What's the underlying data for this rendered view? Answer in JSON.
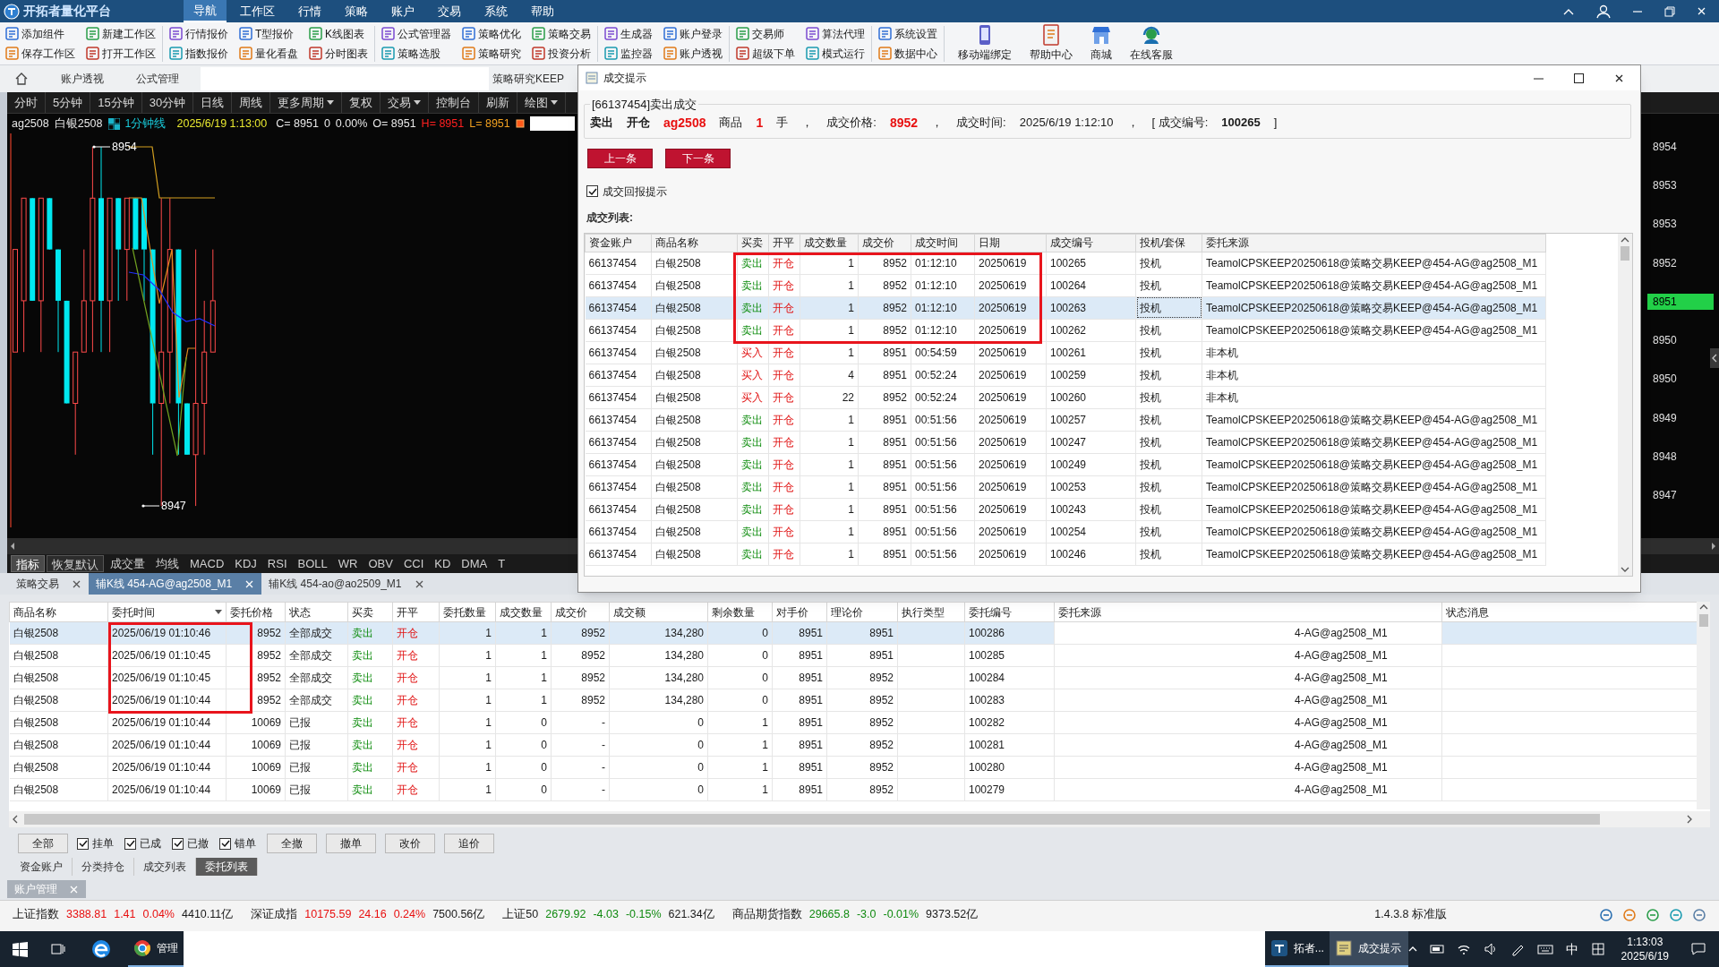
{
  "app": {
    "title": "开拓者量化平台"
  },
  "menu": [
    {
      "label": "导航",
      "selected": true
    },
    {
      "label": "工作区",
      "selected": false
    },
    {
      "label": "行情",
      "selected": false
    },
    {
      "label": "策略",
      "selected": false
    },
    {
      "label": "账户",
      "selected": false
    },
    {
      "label": "交易",
      "selected": false
    },
    {
      "label": "系统",
      "selected": false
    },
    {
      "label": "帮助",
      "selected": false
    }
  ],
  "toolbar": {
    "groups": [
      [
        [
          "添加组件",
          "保存工作区"
        ],
        [
          "新建工作区",
          "打开工作区"
        ]
      ],
      [
        [
          "行情报价",
          "指数报价"
        ],
        [
          "T型报价",
          "量化看盘"
        ],
        [
          "K线图表",
          "分时图表"
        ]
      ],
      [
        [
          "公式管理器",
          "策略选股"
        ],
        [
          "策略优化",
          "策略研究"
        ],
        [
          "策略交易",
          "投资分析"
        ]
      ],
      [
        [
          "生成器",
          "监控器"
        ],
        [
          "账户登录",
          "账户透视"
        ]
      ],
      [
        [
          "交易师",
          "超级下单"
        ],
        [
          "算法代理",
          "模式运行"
        ]
      ],
      [
        [
          "系统设置",
          "数据中心"
        ]
      ]
    ],
    "big_buttons": [
      "移动端绑定",
      "帮助中心",
      "商城",
      "在线客服"
    ]
  },
  "workspace_tabs": [
    "账户透视",
    "公式管理"
  ],
  "workspace_tabs_right": [
    "策略研究KEEP"
  ],
  "chart": {
    "periods": [
      {
        "label": "分时",
        "dropdown": false
      },
      {
        "label": "5分钟",
        "dropdown": false
      },
      {
        "label": "15分钟",
        "dropdown": false
      },
      {
        "label": "30分钟",
        "dropdown": false
      },
      {
        "label": "日线",
        "dropdown": false
      },
      {
        "label": "周线",
        "dropdown": false
      },
      {
        "label": "更多周期",
        "dropdown": true
      },
      {
        "label": "复权",
        "dropdown": false
      },
      {
        "label": "交易",
        "dropdown": true
      },
      {
        "label": "控制台",
        "dropdown": false
      },
      {
        "label": "刷新",
        "dropdown": false
      },
      {
        "label": "绘图",
        "dropdown": true
      }
    ],
    "quote": {
      "symbol": "ag2508",
      "name": "白银2508",
      "period": "1分钟线",
      "time": "2025/6/19 1:13:00",
      "close": "C= 8951",
      "change": "0",
      "pct": "0.00%",
      "open": "O= 8951",
      "high": "H= 8951",
      "low": "L= 8951"
    },
    "high_mark": "8954",
    "low_mark": "8947",
    "price_axis": [
      {
        "label": "8954",
        "selected": false
      },
      {
        "label": "8953",
        "selected": false
      },
      {
        "label": "8953",
        "selected": false
      },
      {
        "label": "8952",
        "selected": false
      },
      {
        "label": "8951",
        "selected": true
      },
      {
        "label": "8950",
        "selected": false
      },
      {
        "label": "8950",
        "selected": false
      },
      {
        "label": "8949",
        "selected": false
      },
      {
        "label": "8948",
        "selected": false
      },
      {
        "label": "8947",
        "selected": false
      }
    ],
    "indicators": [
      {
        "label": "指标",
        "kind": "button",
        "selected": true
      },
      {
        "label": "恢复默认",
        "kind": "button",
        "selected": false
      },
      {
        "label": "成交量",
        "kind": "tab",
        "selected": false
      },
      {
        "label": "均线",
        "kind": "tab",
        "selected": false
      },
      {
        "label": "MACD",
        "kind": "tab",
        "selected": false
      },
      {
        "label": "KDJ",
        "kind": "tab",
        "selected": false
      },
      {
        "label": "RSI",
        "kind": "tab",
        "selected": false
      },
      {
        "label": "BOLL",
        "kind": "tab",
        "selected": false
      },
      {
        "label": "WR",
        "kind": "tab",
        "selected": false
      },
      {
        "label": "OBV",
        "kind": "tab",
        "selected": false
      },
      {
        "label": "CCI",
        "kind": "tab",
        "selected": false
      },
      {
        "label": "KD",
        "kind": "tab",
        "selected": false
      },
      {
        "label": "DMA",
        "kind": "tab",
        "selected": false
      },
      {
        "label": "T",
        "kind": "tab",
        "selected": false
      }
    ]
  },
  "dialog": {
    "title": "成交提示",
    "group_title": "[66137454]卖出成交",
    "summary": [
      {
        "text": "卖出",
        "kind": "strong"
      },
      {
        "text": "开仓",
        "kind": "strong"
      },
      {
        "text": "ag2508",
        "kind": "accent"
      },
      {
        "text": "商品",
        "kind": "plain"
      },
      {
        "text": "1",
        "kind": "accent"
      },
      {
        "text": "手",
        "kind": "plain"
      },
      {
        "text": "，",
        "kind": "plain"
      },
      {
        "text": "成交价格:",
        "kind": "plain"
      },
      {
        "text": "8952",
        "kind": "accent"
      },
      {
        "text": "，",
        "kind": "plain"
      },
      {
        "text": "成交时间:",
        "kind": "plain"
      },
      {
        "text": "2025/6/19 1:12:10",
        "kind": "plain"
      },
      {
        "text": "，",
        "kind": "plain"
      },
      {
        "text": "[ 成交编号:",
        "kind": "plain"
      },
      {
        "text": "100265",
        "kind": "strong"
      },
      {
        "text": "]",
        "kind": "plain"
      }
    ],
    "buttons": [
      "上一条",
      "下一条"
    ],
    "notify": {
      "label": "成交回报提示",
      "checked": true
    },
    "list_label": "成交列表:",
    "table": {
      "columns": [
        "资金账户",
        "商品名称",
        "买卖",
        "开平",
        "成交数量",
        "成交价",
        "成交时间",
        "日期",
        "成交编号",
        "投机/套保",
        "委托来源"
      ],
      "rows": [
        {
          "cells": [
            "66137454",
            "白银2508",
            "卖出",
            "开仓",
            "1",
            "8952",
            "01:12:10",
            "20250619",
            "100265",
            "投机",
            "TeamolCPSKEEP20250618@策略交易KEEP@454-AG@ag2508_M1"
          ],
          "kind": "sell",
          "selected": false,
          "boxed": true
        },
        {
          "cells": [
            "66137454",
            "白银2508",
            "卖出",
            "开仓",
            "1",
            "8952",
            "01:12:10",
            "20250619",
            "100264",
            "投机",
            "TeamolCPSKEEP20250618@策略交易KEEP@454-AG@ag2508_M1"
          ],
          "kind": "sell",
          "selected": false,
          "boxed": true
        },
        {
          "cells": [
            "66137454",
            "白银2508",
            "卖出",
            "开仓",
            "1",
            "8952",
            "01:12:10",
            "20250619",
            "100263",
            "投机",
            "TeamolCPSKEEP20250618@策略交易KEEP@454-AG@ag2508_M1"
          ],
          "kind": "sell",
          "selected": true,
          "boxed": true
        },
        {
          "cells": [
            "66137454",
            "白银2508",
            "卖出",
            "开仓",
            "1",
            "8952",
            "01:12:10",
            "20250619",
            "100262",
            "投机",
            "TeamolCPSKEEP20250618@策略交易KEEP@454-AG@ag2508_M1"
          ],
          "kind": "sell",
          "selected": false,
          "boxed": true
        },
        {
          "cells": [
            "66137454",
            "白银2508",
            "买入",
            "开仓",
            "1",
            "8951",
            "00:54:59",
            "20250619",
            "100261",
            "投机",
            "非本机"
          ],
          "kind": "buy",
          "selected": false,
          "boxed": false
        },
        {
          "cells": [
            "66137454",
            "白银2508",
            "买入",
            "开仓",
            "4",
            "8951",
            "00:52:24",
            "20250619",
            "100259",
            "投机",
            "非本机"
          ],
          "kind": "buy",
          "selected": false,
          "boxed": false
        },
        {
          "cells": [
            "66137454",
            "白银2508",
            "买入",
            "开仓",
            "22",
            "8952",
            "00:52:24",
            "20250619",
            "100260",
            "投机",
            "非本机"
          ],
          "kind": "buy",
          "selected": false,
          "boxed": false
        },
        {
          "cells": [
            "66137454",
            "白银2508",
            "卖出",
            "开仓",
            "1",
            "8951",
            "00:51:56",
            "20250619",
            "100257",
            "投机",
            "TeamolCPSKEEP20250618@策略交易KEEP@454-AG@ag2508_M1"
          ],
          "kind": "sell",
          "selected": false,
          "boxed": false
        },
        {
          "cells": [
            "66137454",
            "白银2508",
            "卖出",
            "开仓",
            "1",
            "8951",
            "00:51:56",
            "20250619",
            "100247",
            "投机",
            "TeamolCPSKEEP20250618@策略交易KEEP@454-AG@ag2508_M1"
          ],
          "kind": "sell",
          "selected": false,
          "boxed": false
        },
        {
          "cells": [
            "66137454",
            "白银2508",
            "卖出",
            "开仓",
            "1",
            "8951",
            "00:51:56",
            "20250619",
            "100249",
            "投机",
            "TeamolCPSKEEP20250618@策略交易KEEP@454-AG@ag2508_M1"
          ],
          "kind": "sell",
          "selected": false,
          "boxed": false
        },
        {
          "cells": [
            "66137454",
            "白银2508",
            "卖出",
            "开仓",
            "1",
            "8951",
            "00:51:56",
            "20250619",
            "100253",
            "投机",
            "TeamolCPSKEEP20250618@策略交易KEEP@454-AG@ag2508_M1"
          ],
          "kind": "sell",
          "selected": false,
          "boxed": false
        },
        {
          "cells": [
            "66137454",
            "白银2508",
            "卖出",
            "开仓",
            "1",
            "8951",
            "00:51:56",
            "20250619",
            "100243",
            "投机",
            "TeamolCPSKEEP20250618@策略交易KEEP@454-AG@ag2508_M1"
          ],
          "kind": "sell",
          "selected": false,
          "boxed": false
        },
        {
          "cells": [
            "66137454",
            "白银2508",
            "卖出",
            "开仓",
            "1",
            "8951",
            "00:51:56",
            "20250619",
            "100254",
            "投机",
            "TeamolCPSKEEP20250618@策略交易KEEP@454-AG@ag2508_M1"
          ],
          "kind": "sell",
          "selected": false,
          "boxed": false
        },
        {
          "cells": [
            "66137454",
            "白银2508",
            "卖出",
            "开仓",
            "1",
            "8951",
            "00:51:56",
            "20250619",
            "100246",
            "投机",
            "TeamolCPSKEEP20250618@策略交易KEEP@454-AG@ag2508_M1"
          ],
          "kind": "sell",
          "selected": false,
          "boxed": false
        }
      ]
    }
  },
  "bottom_panel": {
    "tabs": [
      {
        "label": "策略交易",
        "selected": false
      },
      {
        "label": "辅K线 454-AG@ag2508_M1",
        "selected": true
      },
      {
        "label": "辅K线 454-ao@ao2509_M1",
        "selected": false
      }
    ],
    "orders": {
      "columns": [
        {
          "label": "商品名称",
          "sorted": false
        },
        {
          "label": "委托时间",
          "sorted": true
        },
        {
          "label": "委托价格",
          "sorted": false
        },
        {
          "label": "状态",
          "sorted": false
        },
        {
          "label": "买卖",
          "sorted": false
        },
        {
          "label": "开平",
          "sorted": false
        },
        {
          "label": "委托数量",
          "sorted": false
        },
        {
          "label": "成交数量",
          "sorted": false
        },
        {
          "label": "成交价",
          "sorted": false
        },
        {
          "label": "成交额",
          "sorted": false
        },
        {
          "label": "剩余数量",
          "sorted": false
        },
        {
          "label": "对手价",
          "sorted": false
        },
        {
          "label": "理论价",
          "sorted": false
        },
        {
          "label": "执行类型",
          "sorted": false
        },
        {
          "label": "委托编号",
          "sorted": false
        },
        {
          "label": "委托来源",
          "sorted": false
        },
        {
          "label": "状态消息",
          "sorted": false
        }
      ],
      "rows": [
        {
          "cells": [
            "白银2508",
            "2025/06/19 01:10:46",
            "8952",
            "全部成交",
            "卖出",
            "开仓",
            "1",
            "1",
            "8952",
            "134,280",
            "0",
            "8951",
            "8951",
            null,
            "100286",
            "4-AG@ag2508_M1",
            null
          ],
          "kind": "sell",
          "selected": true,
          "boxed": true
        },
        {
          "cells": [
            "白银2508",
            "2025/06/19 01:10:45",
            "8952",
            "全部成交",
            "卖出",
            "开仓",
            "1",
            "1",
            "8952",
            "134,280",
            "0",
            "8951",
            "8951",
            null,
            "100285",
            "4-AG@ag2508_M1",
            null
          ],
          "kind": "sell",
          "selected": false,
          "boxed": true
        },
        {
          "cells": [
            "白银2508",
            "2025/06/19 01:10:45",
            "8952",
            "全部成交",
            "卖出",
            "开仓",
            "1",
            "1",
            "8952",
            "134,280",
            "0",
            "8951",
            "8952",
            null,
            "100284",
            "4-AG@ag2508_M1",
            null
          ],
          "kind": "sell",
          "selected": false,
          "boxed": true
        },
        {
          "cells": [
            "白银2508",
            "2025/06/19 01:10:44",
            "8952",
            "全部成交",
            "卖出",
            "开仓",
            "1",
            "1",
            "8952",
            "134,280",
            "0",
            "8951",
            "8952",
            null,
            "100283",
            "4-AG@ag2508_M1",
            null
          ],
          "kind": "sell",
          "selected": false,
          "boxed": true
        },
        {
          "cells": [
            "白银2508",
            "2025/06/19 01:10:44",
            "10069",
            "已报",
            "卖出",
            "开仓",
            "1",
            "0",
            "-",
            "0",
            "1",
            "8951",
            "8952",
            null,
            "100282",
            "4-AG@ag2508_M1",
            null
          ],
          "kind": "sell",
          "selected": false,
          "boxed": false
        },
        {
          "cells": [
            "白银2508",
            "2025/06/19 01:10:44",
            "10069",
            "已报",
            "卖出",
            "开仓",
            "1",
            "0",
            "-",
            "0",
            "1",
            "8951",
            "8952",
            null,
            "100281",
            "4-AG@ag2508_M1",
            null
          ],
          "kind": "sell",
          "selected": false,
          "boxed": false
        },
        {
          "cells": [
            "白银2508",
            "2025/06/19 01:10:44",
            "10069",
            "已报",
            "卖出",
            "开仓",
            "1",
            "0",
            "-",
            "0",
            "1",
            "8951",
            "8952",
            null,
            "100280",
            "4-AG@ag2508_M1",
            null
          ],
          "kind": "sell",
          "selected": false,
          "boxed": false
        },
        {
          "cells": [
            "白银2508",
            "2025/06/19 01:10:44",
            "10069",
            "已报",
            "卖出",
            "开仓",
            "1",
            "0",
            "-",
            "0",
            "1",
            "8951",
            "8952",
            null,
            "100279",
            "4-AG@ag2508_M1",
            null
          ],
          "kind": "sell",
          "selected": false,
          "boxed": false
        }
      ]
    },
    "filters": [
      {
        "kind": "button",
        "label": "全部"
      },
      {
        "kind": "checkbox",
        "label": "挂单",
        "checked": true
      },
      {
        "kind": "checkbox",
        "label": "已成",
        "checked": true
      },
      {
        "kind": "checkbox",
        "label": "已撤",
        "checked": true
      },
      {
        "kind": "checkbox",
        "label": "错单",
        "checked": true
      },
      {
        "kind": "button",
        "label": "全撤"
      },
      {
        "kind": "button",
        "label": "撤单"
      },
      {
        "kind": "button",
        "label": "改价"
      },
      {
        "kind": "button",
        "label": "追价"
      }
    ],
    "sub_tabs": [
      {
        "label": "资金账户",
        "selected": false
      },
      {
        "label": "分类持仓",
        "selected": false
      },
      {
        "label": "成交列表",
        "selected": false
      },
      {
        "label": "委托列表",
        "selected": true
      }
    ],
    "account_tab": "账户管理"
  },
  "status_bar": {
    "market": [
      {
        "name": "上证指数",
        "price": "3388.81",
        "change": "1.41",
        "pct": "0.04%",
        "amount": "4410.11亿",
        "kind": "up"
      },
      {
        "name": "深证成指",
        "price": "10175.59",
        "change": "24.16",
        "pct": "0.24%",
        "amount": "7500.56亿",
        "kind": "up"
      },
      {
        "name": "上证50",
        "price": "2679.92",
        "change": "-4.03",
        "pct": "-0.15%",
        "amount": "621.34亿",
        "kind": "down"
      },
      {
        "name": "商品期货指数",
        "price": "29665.8",
        "change": "-3.0",
        "pct": "-0.01%",
        "amount": "9373.52亿",
        "kind": "down"
      }
    ],
    "version": "1.4.3.8 标准版"
  },
  "taskbar": {
    "apps": [
      {
        "label": "管理",
        "kind": "browser",
        "active": false
      },
      {
        "label": "拓者...",
        "kind": "app",
        "active": false
      },
      {
        "label": "成交提示",
        "kind": "dialog",
        "active": true
      }
    ],
    "ime": "中",
    "time": "1:13:03",
    "date": "2025/6/19"
  }
}
